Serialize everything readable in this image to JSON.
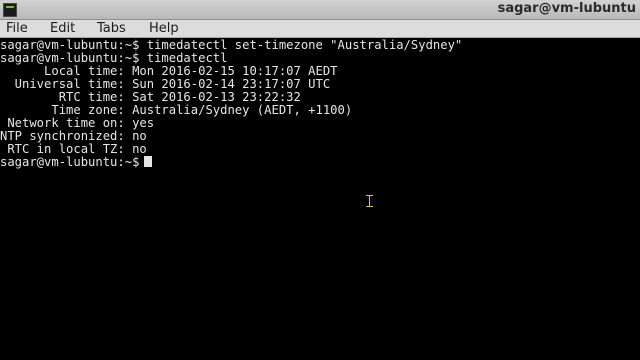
{
  "window": {
    "title": "sagar@vm-lubuntu",
    "icon": "terminal-icon"
  },
  "menubar": {
    "items": [
      "File",
      "Edit",
      "Tabs",
      "Help"
    ]
  },
  "terminal": {
    "lines": [
      "sagar@vm-lubuntu:~$ timedatectl set-timezone \"Australia/Sydney\"",
      "sagar@vm-lubuntu:~$ timedatectl",
      "      Local time: Mon 2016-02-15 10:17:07 AEDT",
      "  Universal time: Sun 2016-02-14 23:17:07 UTC",
      "        RTC time: Sat 2016-02-13 23:22:32",
      "       Time zone: Australia/Sydney (AEDT, +1100)",
      " Network time on: yes",
      "NTP synchronized: no",
      " RTC in local TZ: no",
      "sagar@vm-lubuntu:~$"
    ],
    "foreground": "#e6e6e6",
    "background": "#000000"
  }
}
